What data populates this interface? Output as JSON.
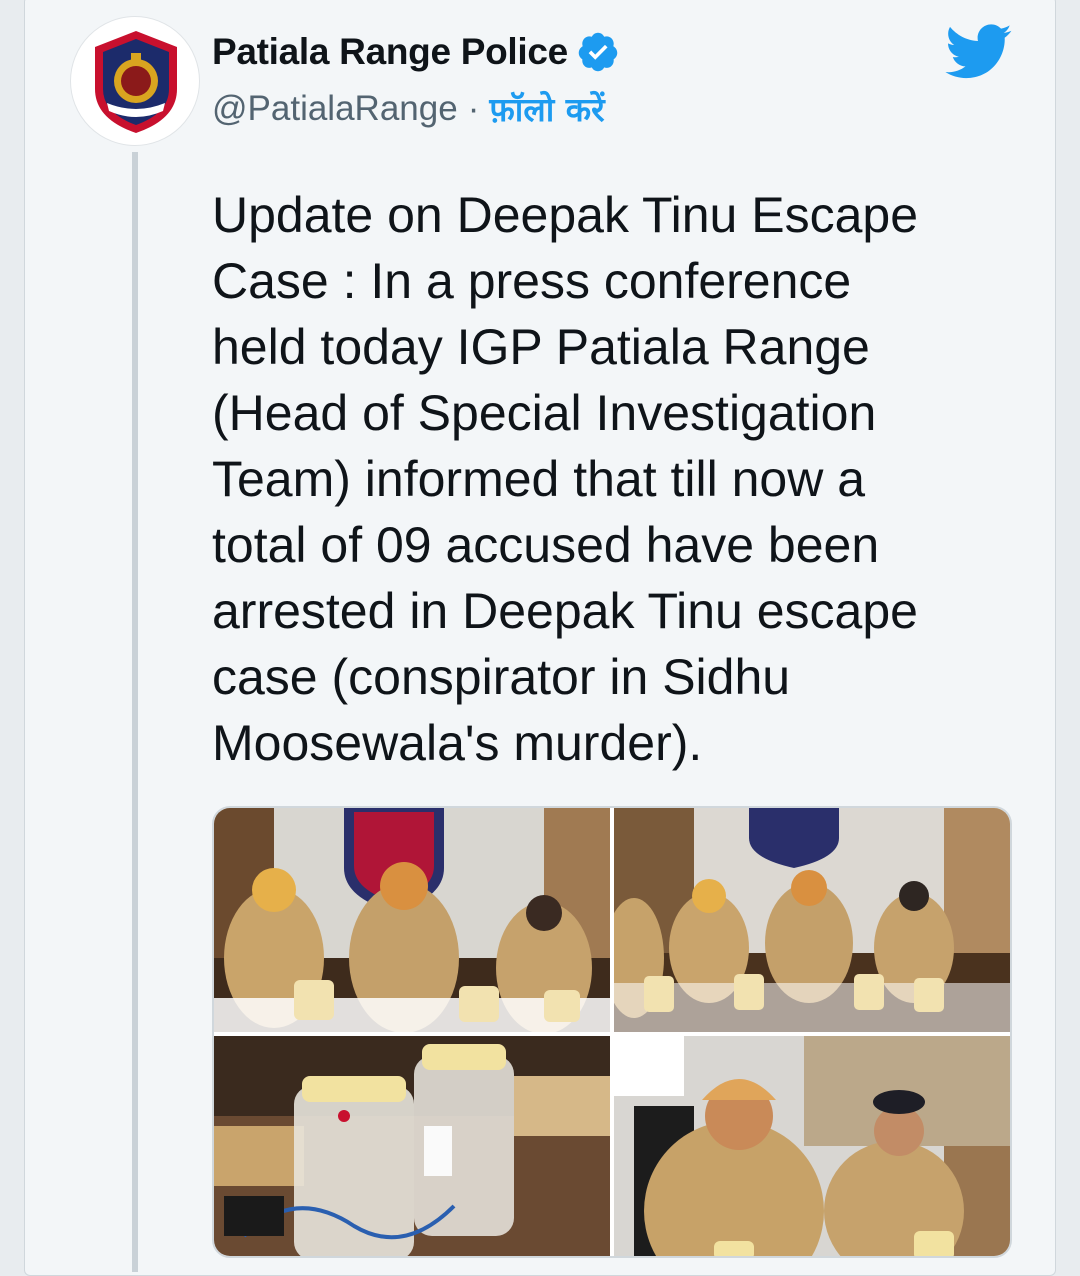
{
  "tweet": {
    "author_name": "Patiala Range Police",
    "handle": "@PatialaRange",
    "separator": "·",
    "follow_label": "फ़ॉलो करें",
    "text": "Update on Deepak Tinu Escape\nCase : In a press conference\nheld today IGP Patiala Range\n(Head of Special Investigation\nTeam) informed that till now a\ntotal of 09 accused have been\narrested in Deepak Tinu escape\ncase (conspirator in Sidhu\nMoosewala's murder).",
    "verified": true
  },
  "icons": {
    "verified": "verified-badge-icon",
    "brand": "twitter-bird-icon",
    "avatar": "punjab-police-logo"
  },
  "media": {
    "photo_count": 4,
    "photos": [
      {
        "name": "press-conference-wide"
      },
      {
        "name": "press-conference-table"
      },
      {
        "name": "evidence-jars"
      },
      {
        "name": "officers-closeup"
      }
    ]
  },
  "colors": {
    "accent": "#1d9bf0",
    "text": "#0f1419",
    "secondary": "#536471"
  }
}
